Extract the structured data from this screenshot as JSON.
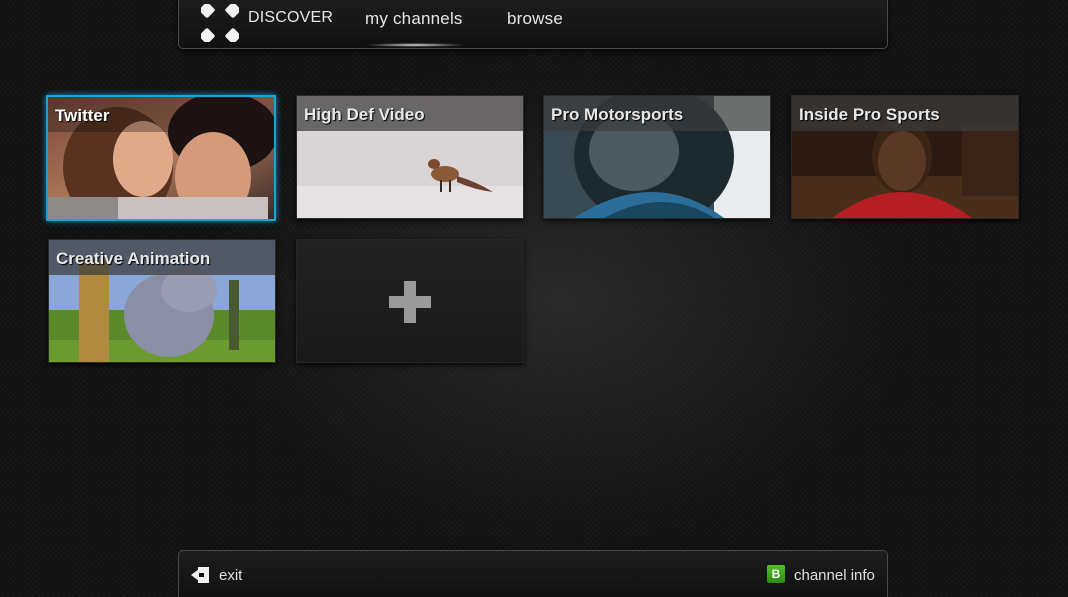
{
  "nav": {
    "brand": "DISCOVER",
    "items": [
      {
        "label": "my channels",
        "active": true
      },
      {
        "label": "browse"
      }
    ],
    "logo_icon": "x-brand-logo-icon"
  },
  "channels": [
    {
      "title": "Twitter",
      "selected": true
    },
    {
      "title": "High Def Video"
    },
    {
      "title": "Pro Motorsports"
    },
    {
      "title": "Inside Pro Sports"
    },
    {
      "title": "Creative Animation"
    }
  ],
  "add_tile": {
    "icon": "plus-icon"
  },
  "footer": {
    "exit_label": "exit",
    "exit_icon": "exit-icon",
    "info_badge": "B",
    "info_label": "channel info"
  },
  "colors": {
    "selection": "#1aa3d6",
    "badge_green": "#3aa41e",
    "background": "#111111"
  }
}
